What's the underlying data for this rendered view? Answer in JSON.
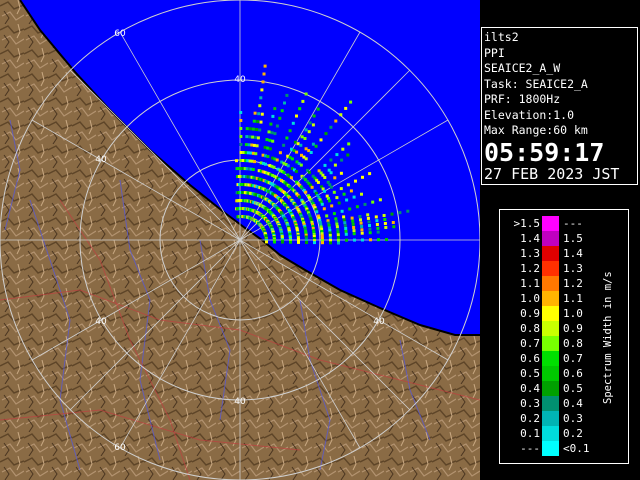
{
  "info": {
    "station": "ilts2",
    "mode": "PPI",
    "scan": "SEAICE2_A_W",
    "task": "Task: SEAICE2_A",
    "prf": "PRF: 1800Hz",
    "elevation": "Elevation:1.0",
    "max_range": "Max Range:60 km",
    "time": "05:59:17",
    "date": "27 FEB 2023 JST"
  },
  "ring_labels": [
    "60",
    "40",
    "40",
    "40",
    "40",
    "40",
    "60"
  ],
  "legend": {
    "title": "Spectrum Width in m/s",
    "rows": [
      {
        "low": ">1.5",
        "high": "---",
        "color": "#ff00ff"
      },
      {
        "low": "1.4",
        "high": "1.5",
        "color": "#c000c0"
      },
      {
        "low": "1.3",
        "high": "1.4",
        "color": "#e00000"
      },
      {
        "low": "1.2",
        "high": "1.3",
        "color": "#ff3000"
      },
      {
        "low": "1.1",
        "high": "1.2",
        "color": "#ff7800"
      },
      {
        "low": "1.0",
        "high": "1.1",
        "color": "#ffb400"
      },
      {
        "low": "0.9",
        "high": "1.0",
        "color": "#ffff00"
      },
      {
        "low": "0.8",
        "high": "0.9",
        "color": "#c8ff00"
      },
      {
        "low": "0.7",
        "high": "0.8",
        "color": "#78ff00"
      },
      {
        "low": "0.6",
        "high": "0.7",
        "color": "#00e000"
      },
      {
        "low": "0.5",
        "high": "0.6",
        "color": "#00c800"
      },
      {
        "low": "0.4",
        "high": "0.5",
        "color": "#00a000"
      },
      {
        "low": "0.3",
        "high": "0.4",
        "color": "#009070"
      },
      {
        "low": "0.2",
        "high": "0.3",
        "color": "#00b4b4"
      },
      {
        "low": "0.1",
        "high": "0.2",
        "color": "#00dcdc"
      },
      {
        "low": "---",
        "high": "<0.1",
        "color": "#00ffff"
      }
    ]
  },
  "colors": {
    "sea": "#0000ff",
    "land": "#8a6b45",
    "ring": "#d0d0d0"
  }
}
